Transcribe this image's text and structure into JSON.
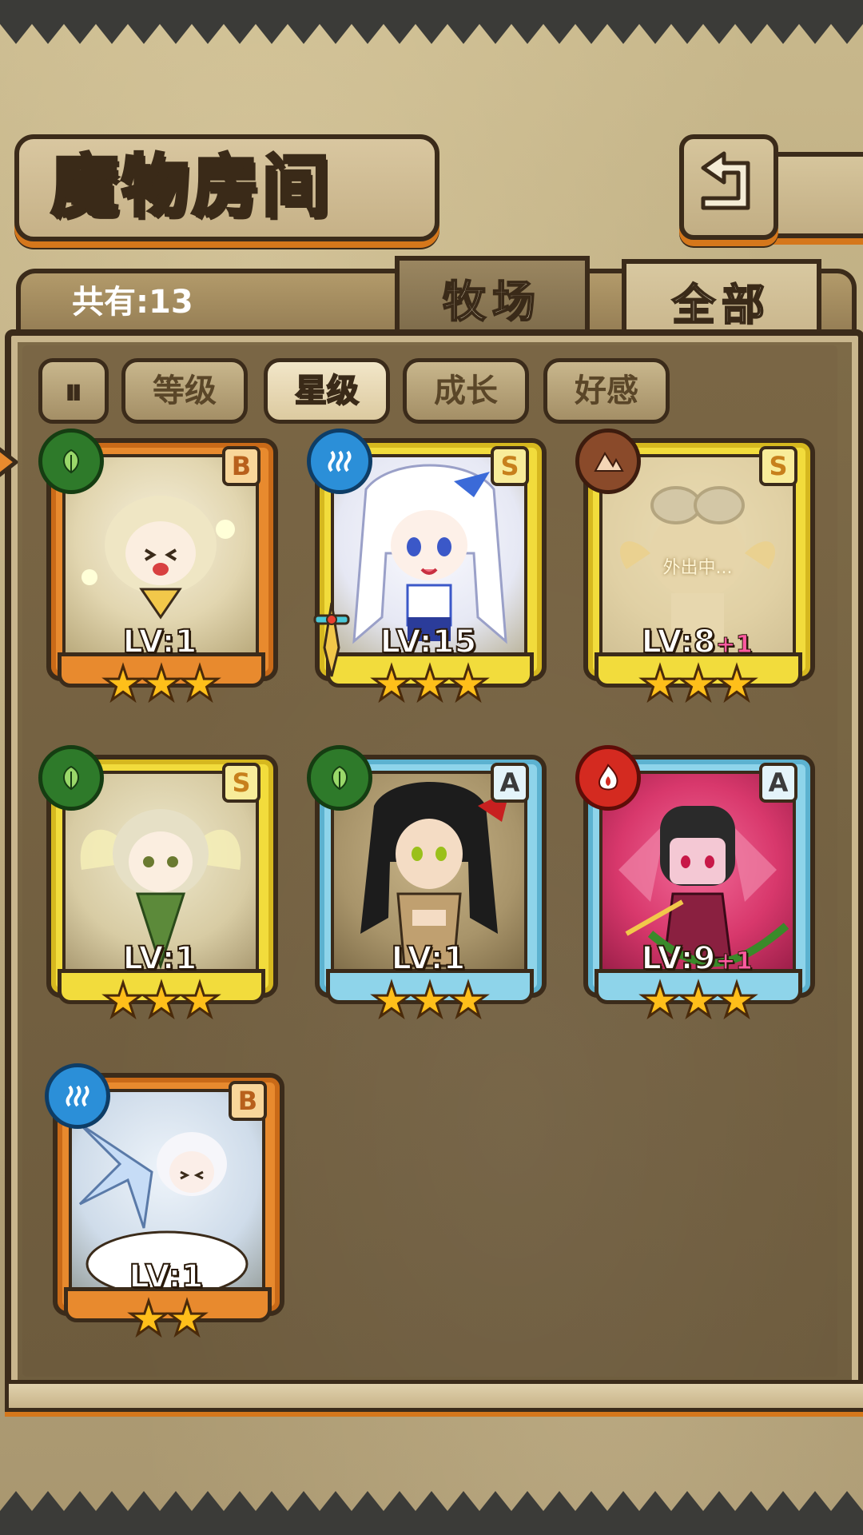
{
  "header": {
    "title": "魔物房间",
    "back_icon": "return-arrow-icon"
  },
  "summary": {
    "count_label": "共有:13"
  },
  "tabs": [
    {
      "label": "牧场",
      "active": false
    },
    {
      "label": "全部",
      "active": true
    }
  ],
  "sort": {
    "toggle_icon": "sort-order-icon",
    "buttons": [
      {
        "label": "等级",
        "active": false
      },
      {
        "label": "星级",
        "active": true
      },
      {
        "label": "成长",
        "active": false
      },
      {
        "label": "好感",
        "active": false
      }
    ]
  },
  "cards": [
    {
      "element": "wood",
      "rank": "B",
      "level": "LV:1",
      "bonus": "",
      "stars": "★★★",
      "frame": "orange",
      "status": ""
    },
    {
      "element": "water",
      "rank": "S",
      "level": "LV:15",
      "bonus": "",
      "stars": "★★★",
      "frame": "gold",
      "status": ""
    },
    {
      "element": "earth",
      "rank": "S",
      "level": "LV:8",
      "bonus": "+1",
      "stars": "★★★",
      "frame": "gold",
      "status": "外出中..."
    },
    {
      "element": "wood",
      "rank": "S",
      "level": "LV:1",
      "bonus": "",
      "stars": "★★★",
      "frame": "gold",
      "status": ""
    },
    {
      "element": "wood",
      "rank": "A",
      "level": "LV:1",
      "bonus": "",
      "stars": "★★★",
      "frame": "blue",
      "status": ""
    },
    {
      "element": "fire",
      "rank": "A",
      "level": "LV:9",
      "bonus": "+1",
      "stars": "★★★",
      "frame": "blue",
      "status": ""
    },
    {
      "element": "water",
      "rank": "B",
      "level": "LV:1",
      "bonus": "",
      "stars": "★★",
      "frame": "orange",
      "status": ""
    }
  ],
  "colors": {
    "gold_frame": "#f2dc3c",
    "orange_frame": "#e88a2e",
    "blue_frame": "#8ed4ea",
    "bonus_pink": "#ff5aa0",
    "star": "#ffbf1a"
  }
}
